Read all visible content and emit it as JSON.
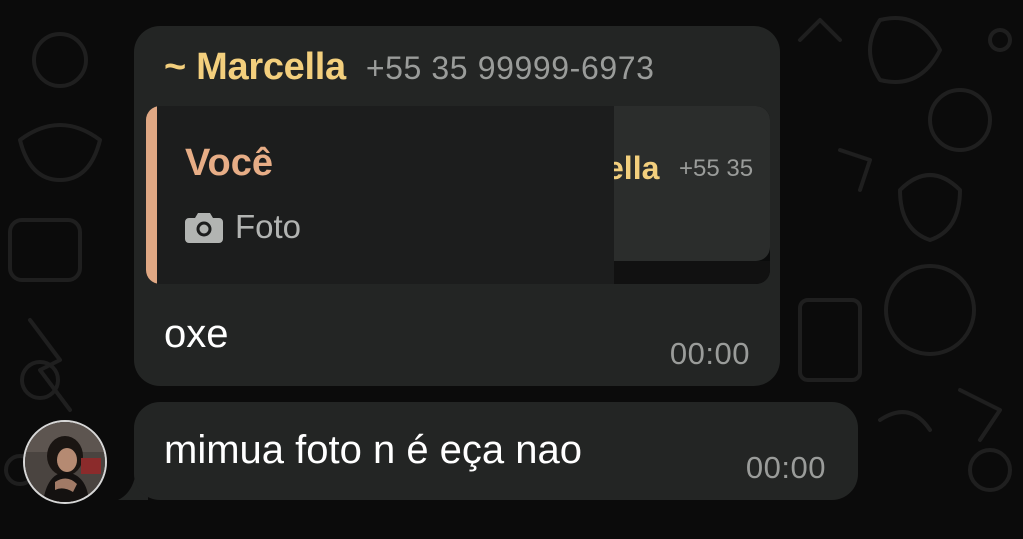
{
  "chat": {
    "messages": [
      {
        "sender_name": "~ Marcella",
        "sender_phone": "+55 35 99999-6973",
        "quoted": {
          "author": "Você",
          "media_icon": "camera-icon",
          "media_label": "Foto",
          "thumbnail_preview": {
            "name": "ella",
            "phone": "+55 35"
          }
        },
        "text": "oxe",
        "time": "00:00"
      },
      {
        "text": "mimua foto n é eça nao",
        "time": "00:00",
        "avatar_icon": "user-avatar"
      }
    ]
  },
  "colors": {
    "background": "#0b0b0b",
    "bubble": "#232524",
    "sender_name": "#f3cf7d",
    "quote_accent": "#e0a884",
    "timestamp": "#9a9c9a"
  }
}
